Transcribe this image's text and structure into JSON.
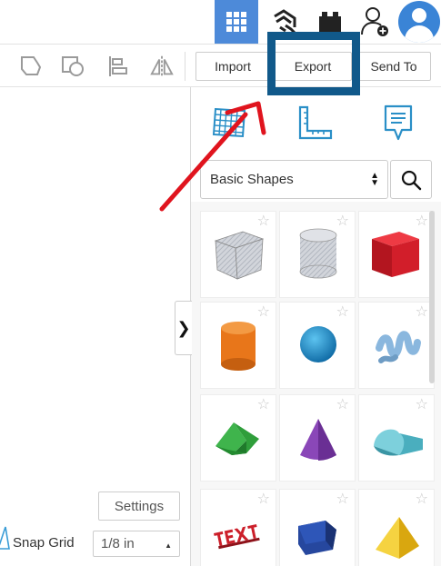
{
  "header": {
    "icons": [
      "grid-view-icon",
      "tinkercad-blocks-icon",
      "bricks-icon",
      "add-user-icon",
      "user-avatar-icon"
    ]
  },
  "toolbar": {
    "icons": [
      "group-icon",
      "ungroup-icon",
      "align-icon",
      "mirror-icon"
    ],
    "import_label": "Import",
    "export_label": "Export",
    "send_to_label": "Send To"
  },
  "panel": {
    "tabs": [
      "workplane-icon",
      "ruler-icon",
      "notes-icon"
    ],
    "category_select": "Basic Shapes",
    "shapes": [
      {
        "name": "box-hole",
        "color": "#b8bcc4"
      },
      {
        "name": "cylinder-hole",
        "color": "#b8bcc4"
      },
      {
        "name": "box",
        "color": "#d21e2a"
      },
      {
        "name": "cylinder",
        "color": "#e8761a"
      },
      {
        "name": "sphere",
        "color": "#1f8fd0"
      },
      {
        "name": "scribble",
        "color": "#8ab7de"
      },
      {
        "name": "roof",
        "color": "#2f9e3b"
      },
      {
        "name": "cone",
        "color": "#7a3aa6"
      },
      {
        "name": "round-roof",
        "color": "#5bbfcf"
      },
      {
        "name": "text",
        "color": "#cc1f2a"
      },
      {
        "name": "polygon",
        "color": "#1f3c8a"
      },
      {
        "name": "pyramid",
        "color": "#f0c41a"
      }
    ]
  },
  "canvas": {
    "settings_label": "Settings",
    "snap_grid_label": "Snap Grid",
    "snap_grid_value": "1/8 in"
  },
  "colors": {
    "accent": "#4d8ad9",
    "highlight_box": "#11598a",
    "arrow": "#e0141e"
  }
}
